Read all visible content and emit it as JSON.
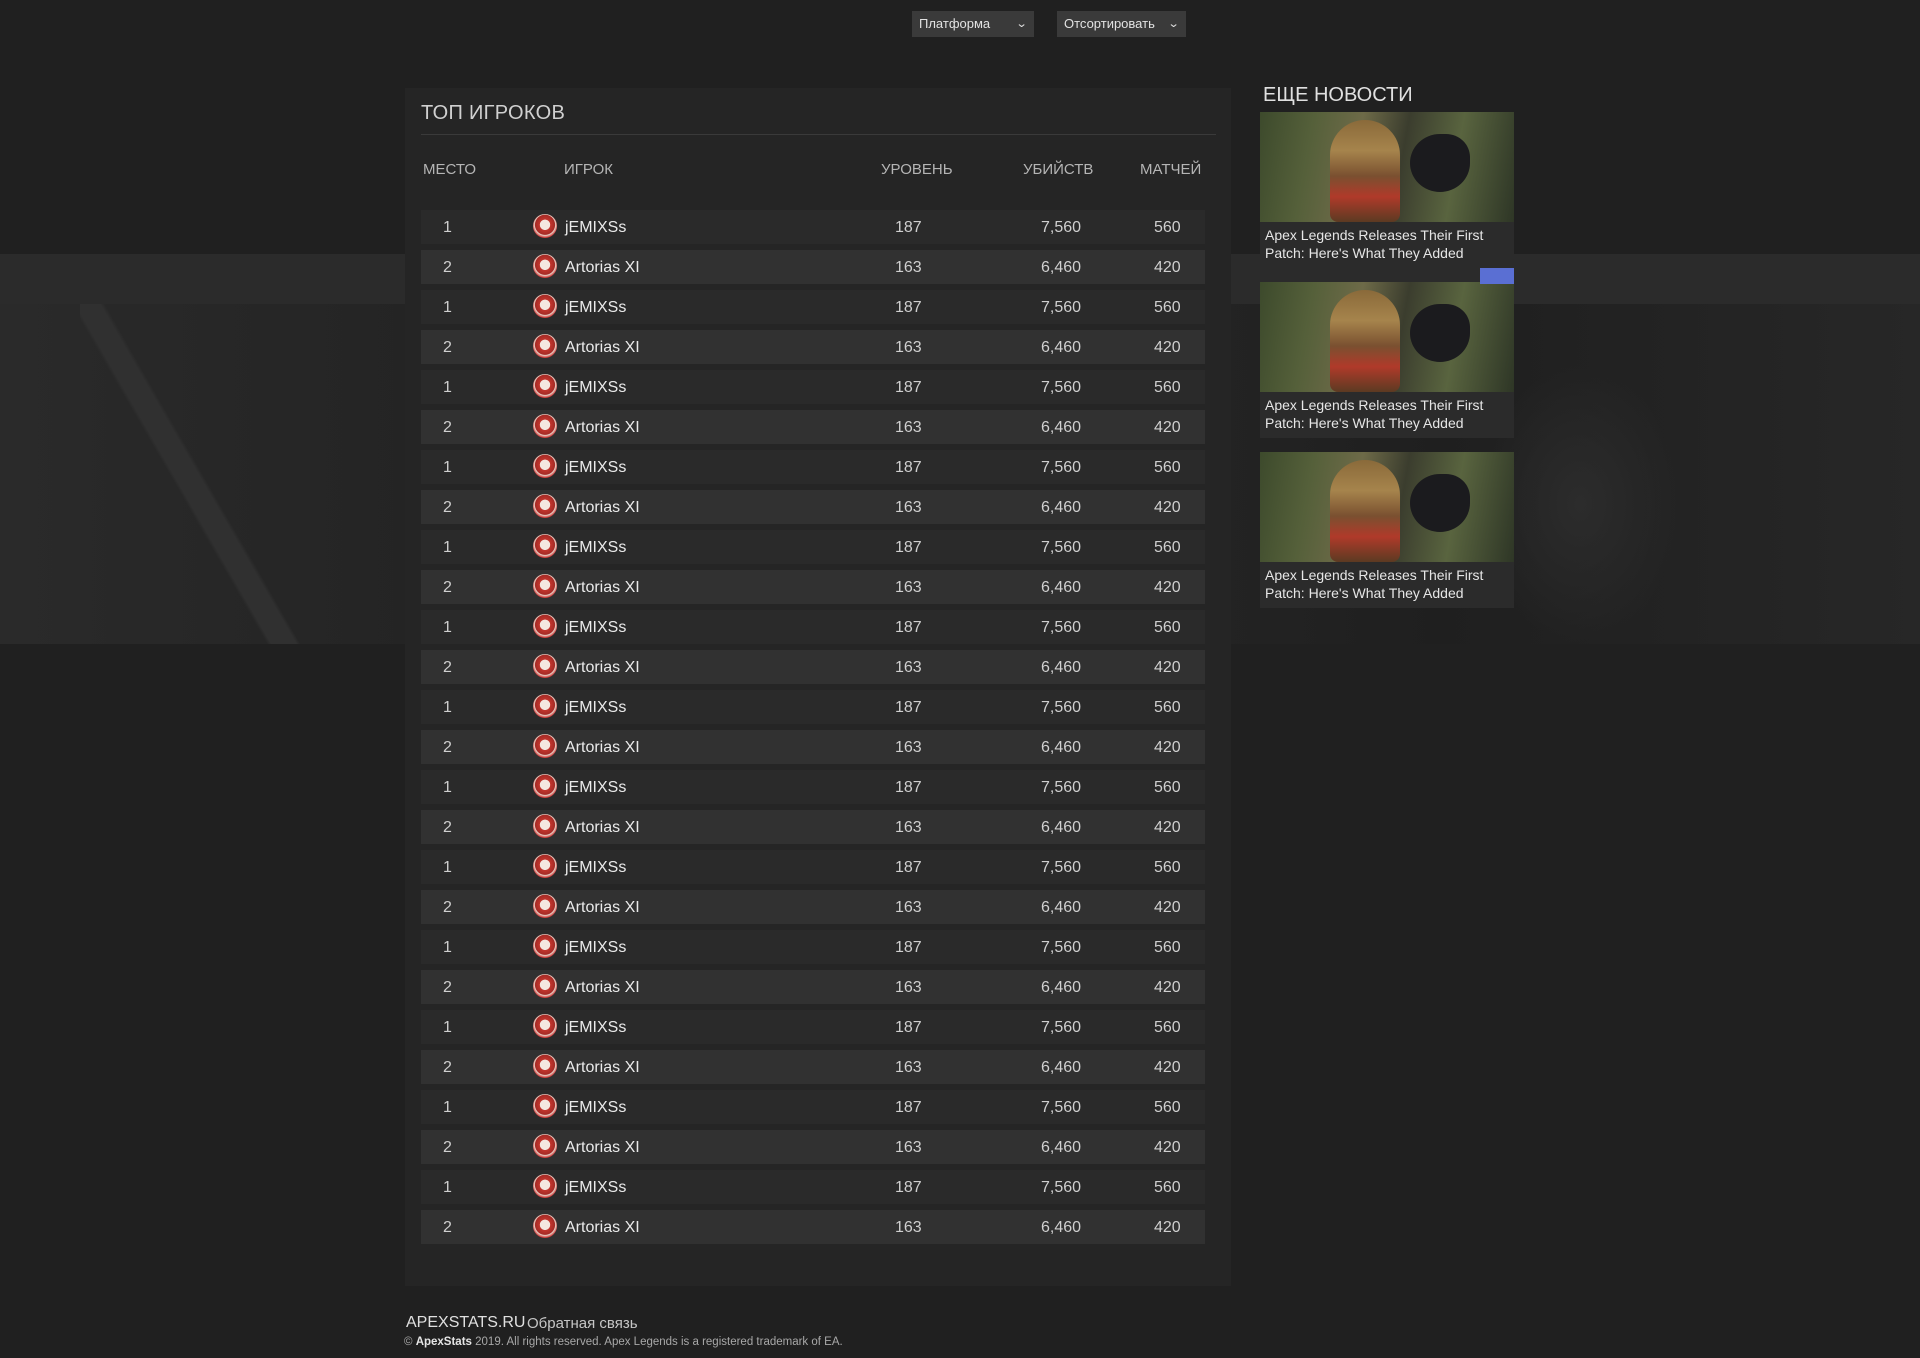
{
  "leaderboard": {
    "title": "ТОП ИГРОКОВ",
    "platform_filter": "Платформа",
    "sort_filter": "Отсортировать",
    "columns": {
      "place": "МЕСТО",
      "player": "ИГРОК",
      "level": "УРОВЕНЬ",
      "kills": "УБИЙСТВ",
      "matches": "МАТЧЕЙ"
    },
    "rows": [
      {
        "place": "1",
        "name": "jEMIXSs",
        "level": "187",
        "kills": "7,560",
        "matches": "560"
      },
      {
        "place": "2",
        "name": "Artorias XI",
        "level": "163",
        "kills": "6,460",
        "matches": "420"
      },
      {
        "place": "1",
        "name": "jEMIXSs",
        "level": "187",
        "kills": "7,560",
        "matches": "560"
      },
      {
        "place": "2",
        "name": "Artorias XI",
        "level": "163",
        "kills": "6,460",
        "matches": "420"
      },
      {
        "place": "1",
        "name": "jEMIXSs",
        "level": "187",
        "kills": "7,560",
        "matches": "560"
      },
      {
        "place": "2",
        "name": "Artorias XI",
        "level": "163",
        "kills": "6,460",
        "matches": "420"
      },
      {
        "place": "1",
        "name": "jEMIXSs",
        "level": "187",
        "kills": "7,560",
        "matches": "560"
      },
      {
        "place": "2",
        "name": "Artorias XI",
        "level": "163",
        "kills": "6,460",
        "matches": "420"
      },
      {
        "place": "1",
        "name": "jEMIXSs",
        "level": "187",
        "kills": "7,560",
        "matches": "560"
      },
      {
        "place": "2",
        "name": "Artorias XI",
        "level": "163",
        "kills": "6,460",
        "matches": "420"
      },
      {
        "place": "1",
        "name": "jEMIXSs",
        "level": "187",
        "kills": "7,560",
        "matches": "560"
      },
      {
        "place": "2",
        "name": "Artorias XI",
        "level": "163",
        "kills": "6,460",
        "matches": "420"
      },
      {
        "place": "1",
        "name": "jEMIXSs",
        "level": "187",
        "kills": "7,560",
        "matches": "560"
      },
      {
        "place": "2",
        "name": "Artorias XI",
        "level": "163",
        "kills": "6,460",
        "matches": "420"
      },
      {
        "place": "1",
        "name": "jEMIXSs",
        "level": "187",
        "kills": "7,560",
        "matches": "560"
      },
      {
        "place": "2",
        "name": "Artorias XI",
        "level": "163",
        "kills": "6,460",
        "matches": "420"
      },
      {
        "place": "1",
        "name": "jEMIXSs",
        "level": "187",
        "kills": "7,560",
        "matches": "560"
      },
      {
        "place": "2",
        "name": "Artorias XI",
        "level": "163",
        "kills": "6,460",
        "matches": "420"
      },
      {
        "place": "1",
        "name": "jEMIXSs",
        "level": "187",
        "kills": "7,560",
        "matches": "560"
      },
      {
        "place": "2",
        "name": "Artorias XI",
        "level": "163",
        "kills": "6,460",
        "matches": "420"
      },
      {
        "place": "1",
        "name": "jEMIXSs",
        "level": "187",
        "kills": "7,560",
        "matches": "560"
      },
      {
        "place": "2",
        "name": "Artorias XI",
        "level": "163",
        "kills": "6,460",
        "matches": "420"
      },
      {
        "place": "1",
        "name": "jEMIXSs",
        "level": "187",
        "kills": "7,560",
        "matches": "560"
      },
      {
        "place": "2",
        "name": "Artorias XI",
        "level": "163",
        "kills": "6,460",
        "matches": "420"
      },
      {
        "place": "1",
        "name": "jEMIXSs",
        "level": "187",
        "kills": "7,560",
        "matches": "560"
      },
      {
        "place": "2",
        "name": "Artorias XI",
        "level": "163",
        "kills": "6,460",
        "matches": "420"
      }
    ],
    "avatar_icon": "player-avatar-icon",
    "dropdown_icon": "chevron-down-icon"
  },
  "news": {
    "title": "ЕЩЕ НОВОСТИ",
    "items": [
      {
        "text": "Apex Legends Releases Their First Patch: Here's What They Added"
      },
      {
        "text": "Apex Legends Releases Their First Patch: Here's What They Added"
      },
      {
        "text": "Apex Legends Releases Their First Patch: Here's What They Added"
      }
    ]
  },
  "footer": {
    "brand": "APEXSTATS.RU",
    "feedback_link": "Обратная связь",
    "copyright_prefix": "©",
    "copyright_brand": "ApexStats",
    "copyright_text": "2019. All rights reserved. Apex Legends is a registered trademark of EA."
  },
  "colors": {
    "page_background": "#202020",
    "panel_background": "#252525",
    "row_odd": "#2a2a2a",
    "row_even": "#313131",
    "select_background": "#3a3a3a",
    "discord_accent": "#5a6fd3"
  }
}
